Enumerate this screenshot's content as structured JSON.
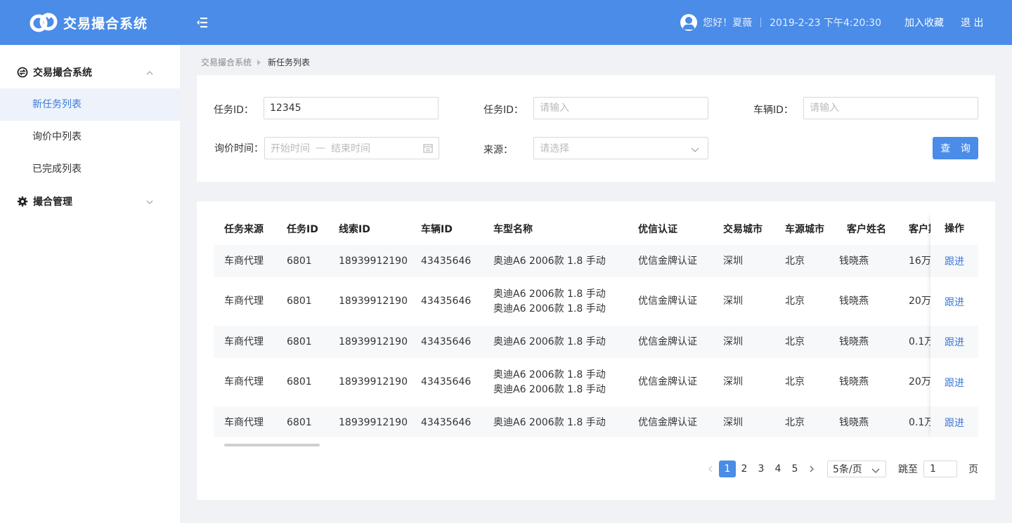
{
  "header": {
    "app_title": "交易撮合系统",
    "greeting": "您好！夏薇",
    "datetime": "2019-2-23 下午4:20:30",
    "favorite_label": "加入收藏",
    "logout_label": "退 出",
    "accent_color": "#4a8ce8"
  },
  "sidebar": {
    "groups": [
      {
        "label": "交易撮合系统",
        "icon": "exchange-icon",
        "expanded": true,
        "items": [
          {
            "label": "新任务列表",
            "active": true
          },
          {
            "label": "询价中列表",
            "active": false
          },
          {
            "label": "已完成列表",
            "active": false
          }
        ]
      },
      {
        "label": "撮合管理",
        "icon": "gear-icon",
        "expanded": false,
        "items": []
      }
    ]
  },
  "breadcrumb": {
    "root": "交易撮合系统",
    "current": "新任务列表"
  },
  "filters": {
    "task_id_1": {
      "label": "任务ID：",
      "value": "12345"
    },
    "task_id_2": {
      "label": "任务ID：",
      "placeholder": "请输入"
    },
    "vehicle_id": {
      "label": "车辆ID：",
      "placeholder": "请输入"
    },
    "inquiry_time": {
      "label": "询价时间：",
      "start_placeholder": "开始时间",
      "separator": "—",
      "end_placeholder": "结束时间"
    },
    "source": {
      "label": "来源：",
      "placeholder": "请选择"
    },
    "query_label": "查 询"
  },
  "table": {
    "columns": [
      "任务来源",
      "任务ID",
      "线索ID",
      "车辆ID",
      "车型名称",
      "优信认证",
      "交易城市",
      "车源城市",
      "客户姓名",
      "客户期"
    ],
    "action_header": "操作",
    "action_label": "跟进",
    "rows": [
      {
        "source": "车商代理",
        "task_id": "6801",
        "lead_id": "18939912190",
        "vehicle_id": "43435646",
        "model": "奥迪A6 2006款 1.8 手动",
        "cert": "优信金牌认证",
        "trade_city": "深圳",
        "source_city": "北京",
        "customer": "钱晓燕",
        "price": "16万"
      },
      {
        "source": "车商代理",
        "task_id": "6801",
        "lead_id": "18939912190",
        "vehicle_id": "43435646",
        "model": "奥迪A6 2006款 1.8 手动 奥迪A6 2006款 1.8 手动",
        "cert": "优信金牌认证",
        "trade_city": "深圳",
        "source_city": "北京",
        "customer": "钱晓燕",
        "price": "20万"
      },
      {
        "source": "车商代理",
        "task_id": "6801",
        "lead_id": "18939912190",
        "vehicle_id": "43435646",
        "model": "奥迪A6 2006款 1.8 手动",
        "cert": "优信金牌认证",
        "trade_city": "深圳",
        "source_city": "北京",
        "customer": "钱晓燕",
        "price": "0.1万"
      },
      {
        "source": "车商代理",
        "task_id": "6801",
        "lead_id": "18939912190",
        "vehicle_id": "43435646",
        "model": "奥迪A6 2006款 1.8 手动 奥迪A6 2006款 1.8 手动",
        "cert": "优信金牌认证",
        "trade_city": "深圳",
        "source_city": "北京",
        "customer": "钱晓燕",
        "price": "20万"
      },
      {
        "source": "车商代理",
        "task_id": "6801",
        "lead_id": "18939912190",
        "vehicle_id": "43435646",
        "model": "奥迪A6 2006款 1.8 手动",
        "cert": "优信金牌认证",
        "trade_city": "深圳",
        "source_city": "北京",
        "customer": "钱晓燕",
        "price": "0.1万"
      }
    ]
  },
  "pagination": {
    "pages": [
      "1",
      "2",
      "3",
      "4",
      "5"
    ],
    "current": "1",
    "page_size": "5条/页",
    "jump_label": "跳至",
    "jump_value": "1",
    "page_unit": "页"
  }
}
